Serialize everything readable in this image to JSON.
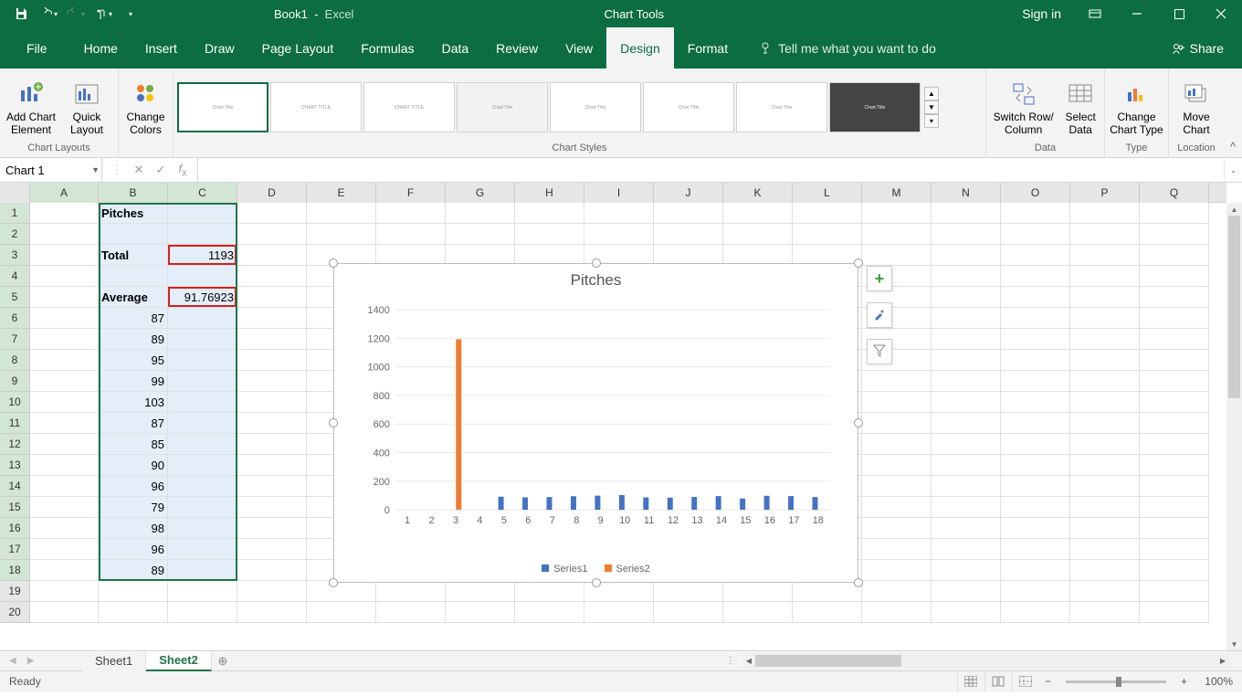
{
  "app": {
    "doc_name": "Book1",
    "app_name": "Excel",
    "context_tab": "Chart Tools",
    "signin": "Sign in"
  },
  "tabs": [
    "File",
    "Home",
    "Insert",
    "Draw",
    "Page Layout",
    "Formulas",
    "Data",
    "Review",
    "View",
    "Design",
    "Format"
  ],
  "active_tab": "Design",
  "tellme": "Tell me what you want to do",
  "share": "Share",
  "ribbon": {
    "group_chart_layouts": "Chart Layouts",
    "add_chart": "Add Chart\nElement",
    "quick_layout": "Quick\nLayout",
    "change_colors": "Change\nColors",
    "group_chart_styles": "Chart Styles",
    "group_data": "Data",
    "switch_row_col": "Switch Row/\nColumn",
    "select_data": "Select\nData",
    "group_type": "Type",
    "change_chart_type": "Change\nChart Type",
    "group_location": "Location",
    "move_chart": "Move\nChart"
  },
  "name_box": "Chart 1",
  "formula": "",
  "columns": [
    "A",
    "B",
    "C",
    "D",
    "E",
    "F",
    "G",
    "H",
    "I",
    "J",
    "K",
    "L",
    "M",
    "N",
    "O",
    "P",
    "Q"
  ],
  "col_widths": {
    "A": 75,
    "B": 76,
    "C": 76,
    "_default": 76
  },
  "rows": 20,
  "cells": {
    "B1": "Pitches",
    "B3": "Total",
    "C3": "1193",
    "B5": "Average",
    "C5": "91.76923",
    "B6": "87",
    "B7": "89",
    "B8": "95",
    "B9": "99",
    "B10": "103",
    "B11": "87",
    "B12": "85",
    "B13": "90",
    "B14": "96",
    "B15": "79",
    "B16": "98",
    "B17": "96",
    "B18": "89"
  },
  "bold_cells": [
    "B1",
    "B3",
    "B5"
  ],
  "right_align": [
    "C3",
    "C5",
    "B6",
    "B7",
    "B8",
    "B9",
    "B10",
    "B11",
    "B12",
    "B13",
    "B14",
    "B15",
    "B16",
    "B17",
    "B18"
  ],
  "redbox_cells": [
    "C3",
    "C5"
  ],
  "sel_range": [
    "B1",
    "C18"
  ],
  "chart": {
    "title": "Pitches",
    "legend": [
      "Series1",
      "Series2"
    ],
    "side_buttons": [
      "plus-icon",
      "brush-icon",
      "filter-icon"
    ]
  },
  "chart_data": {
    "type": "bar",
    "categories": [
      1,
      2,
      3,
      4,
      5,
      6,
      7,
      8,
      9,
      10,
      11,
      12,
      13,
      14,
      15,
      16,
      17,
      18
    ],
    "series": [
      {
        "name": "Series1",
        "color": "#4472c4",
        "values": [
          null,
          null,
          null,
          null,
          91.76923,
          87,
          89,
          95,
          99,
          103,
          87,
          85,
          90,
          96,
          79,
          98,
          96,
          89
        ]
      },
      {
        "name": "Series2",
        "color": "#ed7d31",
        "values": [
          null,
          null,
          1193,
          null,
          null,
          null,
          null,
          null,
          null,
          null,
          null,
          null,
          null,
          null,
          null,
          null,
          null,
          null
        ]
      }
    ],
    "ylim": [
      0,
      1400
    ],
    "yticks": [
      0,
      200,
      400,
      600,
      800,
      1000,
      1200,
      1400
    ],
    "xlabel": "",
    "ylabel": ""
  },
  "sheet_tabs": [
    "Sheet1",
    "Sheet2"
  ],
  "active_sheet": "Sheet2",
  "status": {
    "ready": "Ready",
    "zoom": "100%"
  }
}
